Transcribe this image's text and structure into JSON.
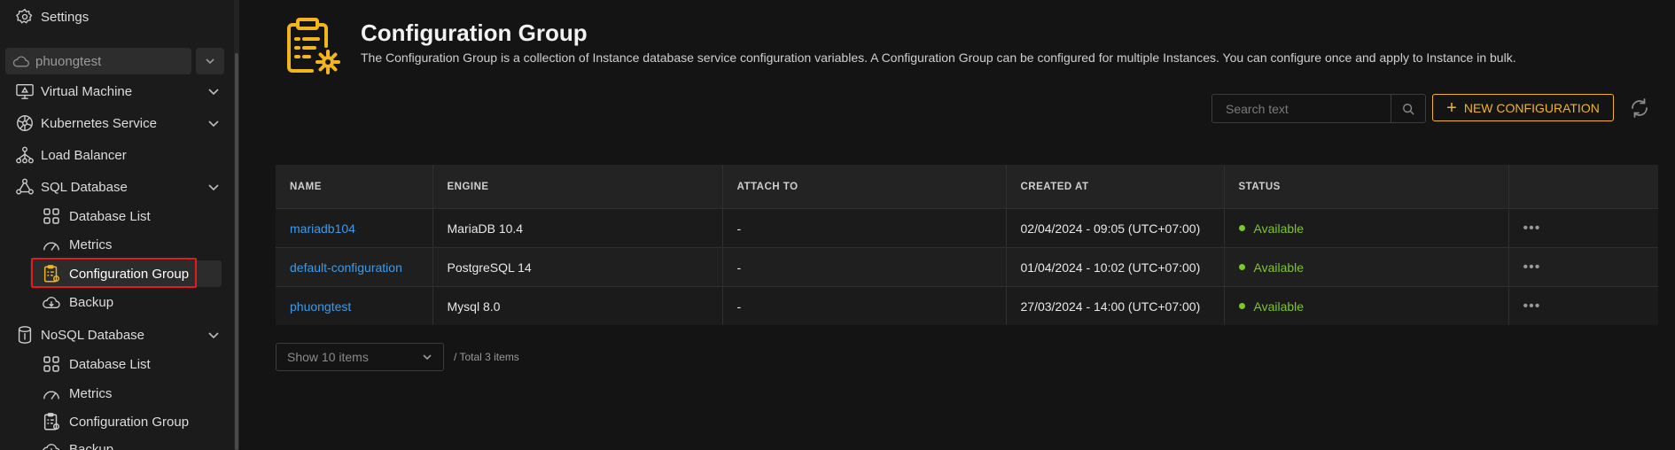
{
  "sidebar": {
    "settings_label": "Settings",
    "project_name": "phuongtest",
    "items": [
      {
        "label": "Virtual Machine"
      },
      {
        "label": "Kubernetes Service"
      },
      {
        "label": "Load Balancer"
      },
      {
        "label": "SQL Database"
      },
      {
        "label": "Database List"
      },
      {
        "label": "Metrics"
      },
      {
        "label": "Configuration Group"
      },
      {
        "label": "Backup"
      },
      {
        "label": "NoSQL Database"
      },
      {
        "label": "Database List"
      },
      {
        "label": "Metrics"
      },
      {
        "label": "Configuration Group"
      },
      {
        "label": "Backup"
      }
    ]
  },
  "header": {
    "title": "Configuration Group",
    "description": "The Configuration Group is a collection of Instance database service configuration variables. A Configuration Group can be configured for multiple Instances. You can configure once and apply to Instance in bulk."
  },
  "toolbar": {
    "search_placeholder": "Search text",
    "new_button_label": "NEW CONFIGURATION"
  },
  "table": {
    "headers": [
      "NAME",
      "ENGINE",
      "ATTACH TO",
      "CREATED AT",
      "STATUS"
    ],
    "rows": [
      {
        "name": "mariadb104",
        "engine": "MariaDB 10.4",
        "attach_to": "-",
        "created_at": "02/04/2024 - 09:05 (UTC+07:00)",
        "status": "Available"
      },
      {
        "name": "default-configuration",
        "engine": "PostgreSQL 14",
        "attach_to": "-",
        "created_at": "01/04/2024 - 10:02 (UTC+07:00)",
        "status": "Available"
      },
      {
        "name": "phuongtest",
        "engine": "Mysql 8.0",
        "attach_to": "-",
        "created_at": "27/03/2024 - 14:00 (UTC+07:00)",
        "status": "Available"
      }
    ],
    "more_glyph": "•••"
  },
  "pagination": {
    "page_size_label": "Show 10 items",
    "total_label": "/ Total 3 items"
  },
  "colors": {
    "accent": "#f2b51d",
    "link": "#3d9be9",
    "status_available": "#7ec52e",
    "highlight_outline": "#e01c1c"
  }
}
